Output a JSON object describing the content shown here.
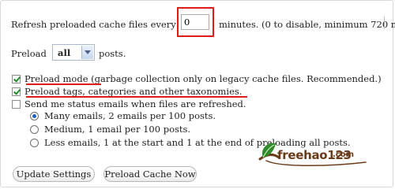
{
  "refresh": {
    "before": "Refresh preloaded cache files every",
    "value": "0",
    "after": "minutes. (0 to disable, minimum 720 m"
  },
  "preload": {
    "label": "Preload",
    "selected": "all",
    "after": "posts."
  },
  "options": {
    "preload_mode": {
      "label": "Preload mode (garbage collection only on legacy cache files. Recommended.)",
      "checked": true
    },
    "preload_tags": {
      "label": "Preload tags, categories and other taxonomies.",
      "checked": true
    },
    "status_emails": {
      "label": "Send me status emails when files are refreshed.",
      "checked": false
    }
  },
  "email_frequency": [
    {
      "label": "Many emails, 2 emails per 100 posts.",
      "selected": true
    },
    {
      "label": "Medium, 1 email per 100 posts.",
      "selected": false
    },
    {
      "label": "Less emails, 1 at the start and 1 at the end of preloading all posts.",
      "selected": false
    }
  ],
  "buttons": {
    "update": "Update Settings",
    "preload_now": "Preload Cache Now"
  },
  "watermark": {
    "text": "freehao123",
    "domain": ".com"
  },
  "colors": {
    "annotation_red": "#e01b1b",
    "checkbox_green": "#1d8a2a",
    "watermark_green": "#2f8a2a",
    "watermark_brown": "#6a3b18"
  }
}
